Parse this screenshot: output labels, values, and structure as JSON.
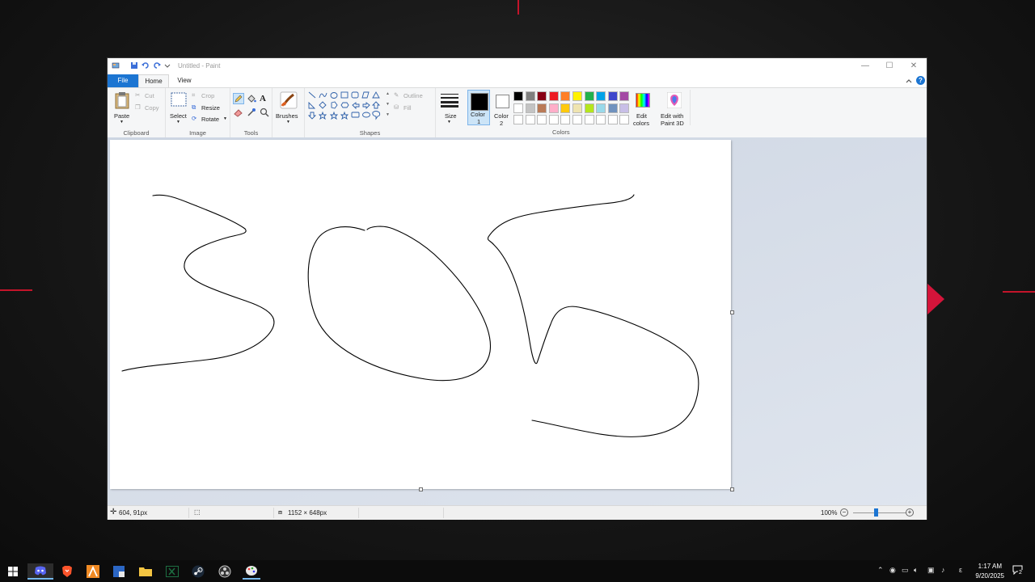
{
  "window": {
    "title": "Untitled - Paint",
    "controls": {
      "minimize": "—",
      "maximize": "☐",
      "close": "✕"
    }
  },
  "menu": {
    "file": "File",
    "home": "Home",
    "view": "View"
  },
  "ribbon": {
    "clipboard": {
      "label": "Clipboard",
      "paste": "Paste",
      "cut": "Cut",
      "copy": "Copy"
    },
    "image": {
      "label": "Image",
      "select": "Select",
      "crop": "Crop",
      "resize": "Resize",
      "rotate": "Rotate"
    },
    "tools": {
      "label": "Tools"
    },
    "brushes": {
      "label": "Brushes"
    },
    "shapes": {
      "label": "Shapes",
      "outline": "Outline",
      "fill": "Fill"
    },
    "size": {
      "label": "Size"
    },
    "color1": {
      "label_line1": "Color",
      "label_line2": "1"
    },
    "color2": {
      "label_line1": "Color",
      "label_line2": "2"
    },
    "colors": {
      "label": "Colors",
      "edit_line1": "Edit",
      "edit_line2": "colors"
    },
    "paint3d": {
      "line1": "Edit with",
      "line2": "Paint 3D"
    }
  },
  "palette": {
    "row1": [
      "#000000",
      "#7f7f7f",
      "#880015",
      "#ed1c24",
      "#ff7f27",
      "#fff200",
      "#22b14c",
      "#00a2e8",
      "#3f48cc",
      "#a349a4"
    ],
    "row2": [
      "#ffffff",
      "#c3c3c3",
      "#b97a57",
      "#ffaec9",
      "#ffc90e",
      "#efe4b0",
      "#b5e61d",
      "#99d9ea",
      "#7092be",
      "#c8bfe7"
    ],
    "row3": [
      "#ffffff",
      "#ffffff",
      "#ffffff",
      "#ffffff",
      "#ffffff",
      "#ffffff",
      "#ffffff",
      "#ffffff",
      "#ffffff",
      "#ffffff"
    ]
  },
  "status": {
    "cursor_position": "604, 91px",
    "canvas_size": "1152 × 648px",
    "zoom": "100%"
  },
  "taskbar": {
    "time": "1:17 AM",
    "date": "9/20/2025",
    "apps": [
      "windows-start",
      "discord",
      "brave",
      "affinity",
      "visual-studio",
      "file-explorer",
      "excel",
      "steam",
      "obs",
      "paint"
    ],
    "notification_count": "2"
  },
  "colors": {
    "accent": "#1c75d2",
    "desktop_accent": "#c4142a"
  }
}
